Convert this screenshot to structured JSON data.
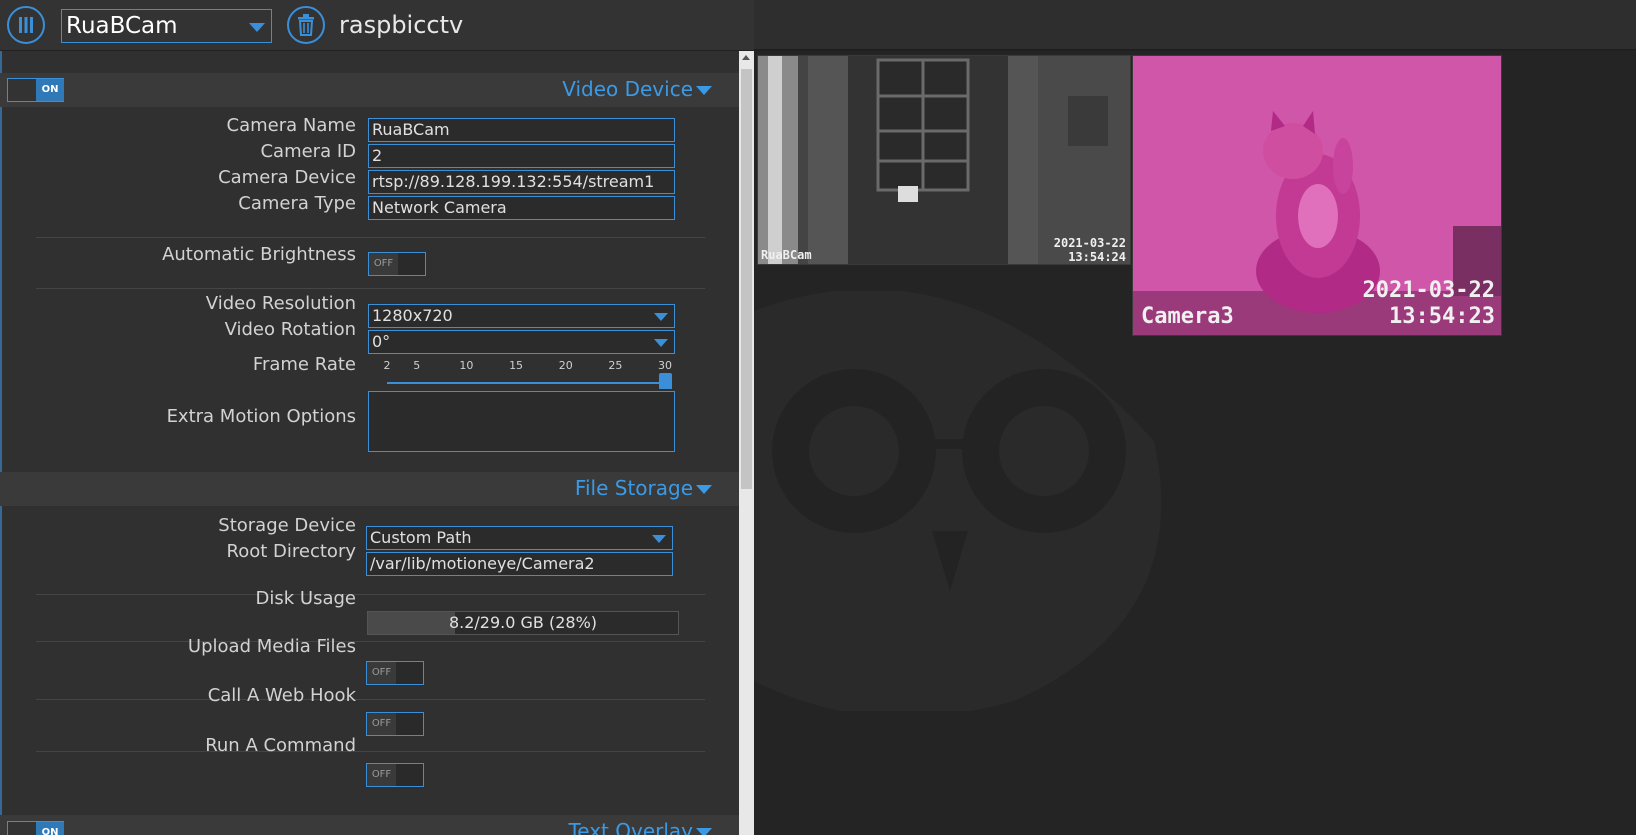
{
  "header": {
    "camera_select": "RuaBCam",
    "hostname": "raspbicctv"
  },
  "video_device": {
    "enabled_label": "ON",
    "title": "Video Device",
    "camera_name_label": "Camera Name",
    "camera_name": "RuaBCam",
    "camera_id_label": "Camera ID",
    "camera_id": "2",
    "camera_device_label": "Camera Device",
    "camera_device": "rtsp://89.128.199.132:554/stream1",
    "camera_type_label": "Camera Type",
    "camera_type": "Network Camera",
    "auto_brightness_label": "Automatic Brightness",
    "auto_brightness": "OFF",
    "resolution_label": "Video Resolution",
    "resolution": "1280x720",
    "rotation_label": "Video Rotation",
    "rotation": "0°",
    "frame_rate_label": "Frame Rate",
    "frame_rate_ticks": [
      "2",
      "5",
      "10",
      "15",
      "20",
      "25",
      "30"
    ],
    "frame_rate": 30,
    "frame_rate_min": 2,
    "frame_rate_max": 30,
    "extra_motion_label": "Extra Motion Options",
    "extra_motion": ""
  },
  "file_storage": {
    "title": "File Storage",
    "storage_device_label": "Storage Device",
    "storage_device": "Custom Path",
    "root_directory_label": "Root Directory",
    "root_directory": "/var/lib/motioneye/Camera2",
    "disk_usage_label": "Disk Usage",
    "disk_usage_text": "8.2/29.0 GB (28%)",
    "disk_usage_fraction": 0.28,
    "upload_media_label": "Upload Media Files",
    "upload_media": "OFF",
    "web_hook_label": "Call A Web Hook",
    "web_hook": "OFF",
    "run_command_label": "Run A Command",
    "run_command": "OFF"
  },
  "text_overlay": {
    "enabled_label": "ON",
    "title": "Text Overlay"
  },
  "cameras": [
    {
      "name": "RuaBCam",
      "date": "2021-03-22",
      "time": "13:54:24"
    },
    {
      "name": "Camera3",
      "date": "2021-03-22",
      "time": "13:54:23"
    }
  ],
  "colors": {
    "accent": "#3b8fd9",
    "panel_bg": "#303030",
    "camera_bg": "#242424"
  }
}
